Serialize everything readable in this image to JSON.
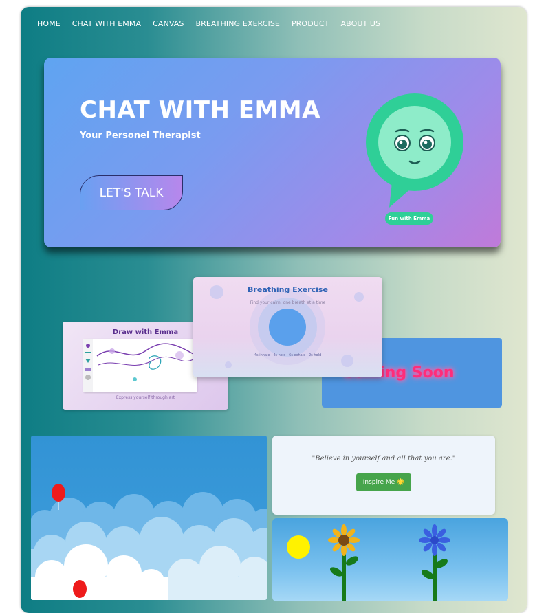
{
  "nav": {
    "items": [
      "HOME",
      "CHAT WITH EMMA",
      "CANVAS",
      "BREATHING EXERCISE",
      "PRODUCT",
      "ABOUT US"
    ]
  },
  "hero": {
    "title": "CHAT WITH EMMA",
    "subtitle": "Your Personel Therapist",
    "cta_label": "LET'S TALK",
    "fun_label": "Fun with Emma"
  },
  "cards": {
    "draw": {
      "title": "Draw with Emma",
      "caption": "Express yourself through art"
    },
    "breathing": {
      "title": "Breathing Exercise",
      "subtitle": "Find your calm, one breath at a time",
      "steps": "4s inhale · 4s hold · 6s exhale · 2s hold"
    },
    "coming_soon": {
      "label": "Coming Soon"
    }
  },
  "quote": {
    "text": "\"Believe in yourself and all that you are.\"",
    "button_label": "Inspire Me 🌟"
  },
  "colors": {
    "accent_green": "#2fcf97",
    "hero_start": "#5fa4f1",
    "hero_end": "#c07ad9",
    "inspire_green": "#46a44b"
  }
}
